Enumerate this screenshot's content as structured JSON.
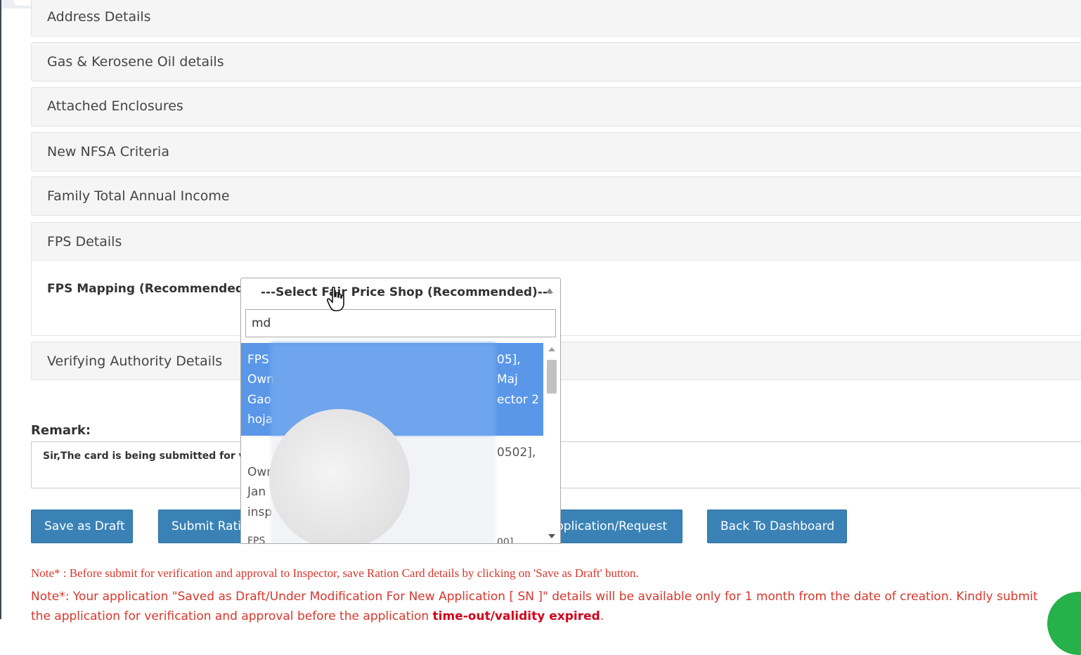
{
  "panels": [
    {
      "title": "Address Details"
    },
    {
      "title": "Gas & Kerosene Oil details"
    },
    {
      "title": "Attached Enclosures"
    },
    {
      "title": "New NFSA Criteria"
    },
    {
      "title": "Family Total Annual Income"
    },
    {
      "title": "FPS Details"
    },
    {
      "title": "Verifying Authority Details"
    }
  ],
  "fps": {
    "label": "FPS Mapping (Recommended):",
    "select_value": "---Select Fair Price Shop (Recommended)---",
    "search_value": "md",
    "option1_lines": [
      "FPS",
      "Own",
      "Gao",
      "hoja"
    ],
    "option1_right": [
      "05],",
      "Maj",
      "ector 2"
    ],
    "option2_lines": [
      "Own",
      "Jan",
      "insp",
      "FPS"
    ],
    "option2_right": [
      "0502],",
      "00]"
    ]
  },
  "remark": {
    "label": "Remark:",
    "text": "Sir,The card is being submitted for ve"
  },
  "buttons": {
    "save_draft": "Save as Draft",
    "submit": "Submit Rati",
    "application": "pplication/Request",
    "back": "Back To Dashboard"
  },
  "notes": {
    "note1": "Note* : Before submit for verification and approval to Inspector, save Ration Card details by clicking on 'Save as Draft' button.",
    "note2_a": "Note*: Your application \"Saved as Draft/Under Modification For New Application [ SN ]\" details will be available only for 1 month from the date of creation. Kindly submit the application for verification and approval before the application ",
    "note2_bold": "time-out/validity expired",
    "note2_end": "."
  }
}
